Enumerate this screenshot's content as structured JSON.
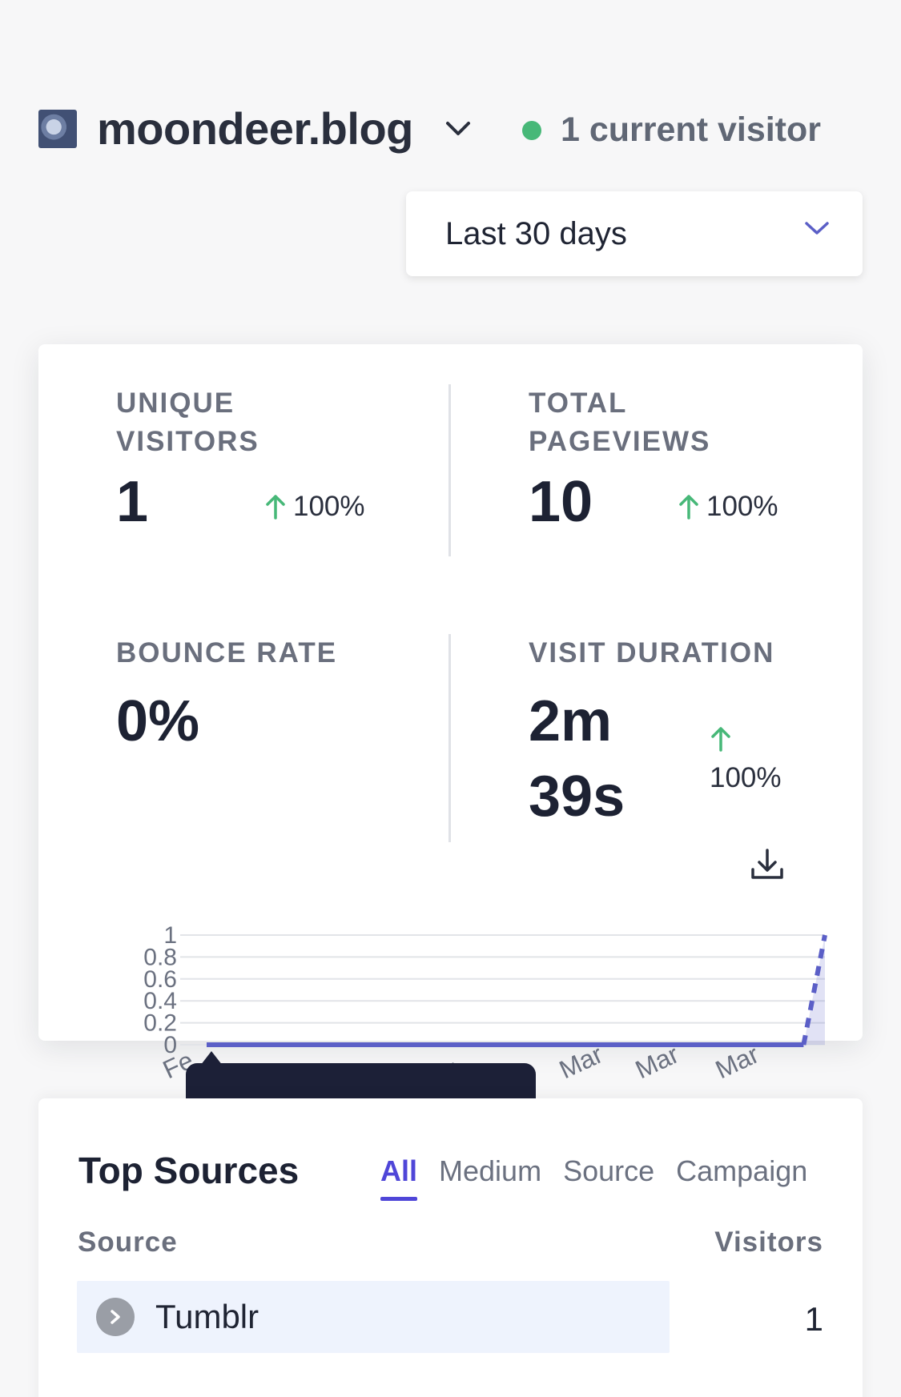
{
  "site": {
    "name": "moondeer.blog",
    "favicon_icon": "moon-icon"
  },
  "realtime": {
    "label": "1 current visitor",
    "dot_color": "#47b878"
  },
  "period": {
    "label": "Last 30 days"
  },
  "metrics": {
    "unique_visitors": {
      "label_line1": "UNIQUE",
      "label_line2": "VISITORS",
      "value": "1",
      "delta": "100%"
    },
    "total_pageviews": {
      "label_line1": "TOTAL",
      "label_line2": "PAGEVIEWS",
      "value": "10",
      "delta": "100%"
    },
    "bounce_rate": {
      "label": "BOUNCE RATE",
      "value": "0%"
    },
    "visit_duration": {
      "label": "VISIT DURATION",
      "value_line1": "2m",
      "value_line2": "39s",
      "delta": "100%"
    }
  },
  "colors": {
    "accent": "#4f46d8",
    "up": "#47b878",
    "series": "#5b5fc7"
  },
  "chart_data": {
    "type": "line",
    "ylim": [
      0,
      1
    ],
    "yticks": [
      "1",
      "0.8",
      "0.6",
      "0.4",
      "0.2",
      "0"
    ],
    "xtick_labels": [
      "Fe",
      "t",
      "Mar",
      "Mar",
      "Mar"
    ],
    "series": [
      {
        "values": [
          0,
          0,
          0,
          0,
          0,
          0,
          0,
          0,
          0,
          0,
          0,
          0,
          0,
          0,
          0,
          0,
          0,
          0,
          0,
          0,
          0,
          0,
          0,
          0,
          0,
          0,
          0,
          0,
          0,
          1
        ]
      }
    ]
  },
  "sources": {
    "title": "Top Sources",
    "tabs": [
      "All",
      "Medium",
      "Source",
      "Campaign"
    ],
    "col_source": "Source",
    "col_visitors": "Visitors",
    "rows": [
      {
        "label": "Tumblr",
        "value": "1"
      }
    ]
  }
}
